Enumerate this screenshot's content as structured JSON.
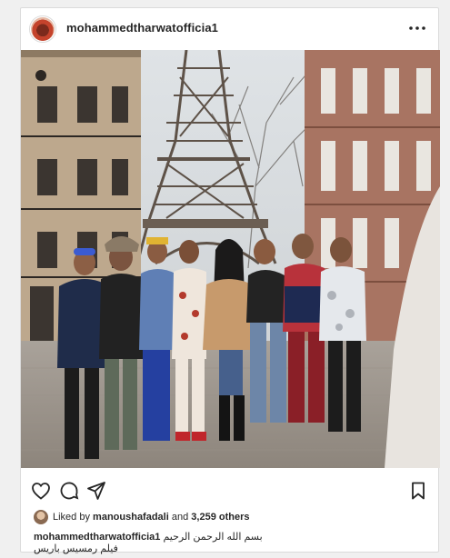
{
  "post": {
    "username": "mohammedtharwatofficia1",
    "more_icon": "more-horizontal-icon",
    "photo_description_alt": "",
    "likes": {
      "prefix": "Liked by",
      "liker": "manoushafadali",
      "conjunction": "and",
      "others": "3,259 others"
    },
    "caption": {
      "author": "mohammedtharwatofficia1",
      "line1": "بسم الله الرحمن الرحيم",
      "line2": "فيلم رمسيس باريس"
    },
    "actions": {
      "like_icon": "heart-icon",
      "comment_icon": "comment-icon",
      "share_icon": "send-icon",
      "save_icon": "bookmark-icon"
    }
  },
  "colors": {
    "text": "#262626",
    "border": "#dbdbdb",
    "background": "#ffffff",
    "page": "#f0f0f0"
  }
}
